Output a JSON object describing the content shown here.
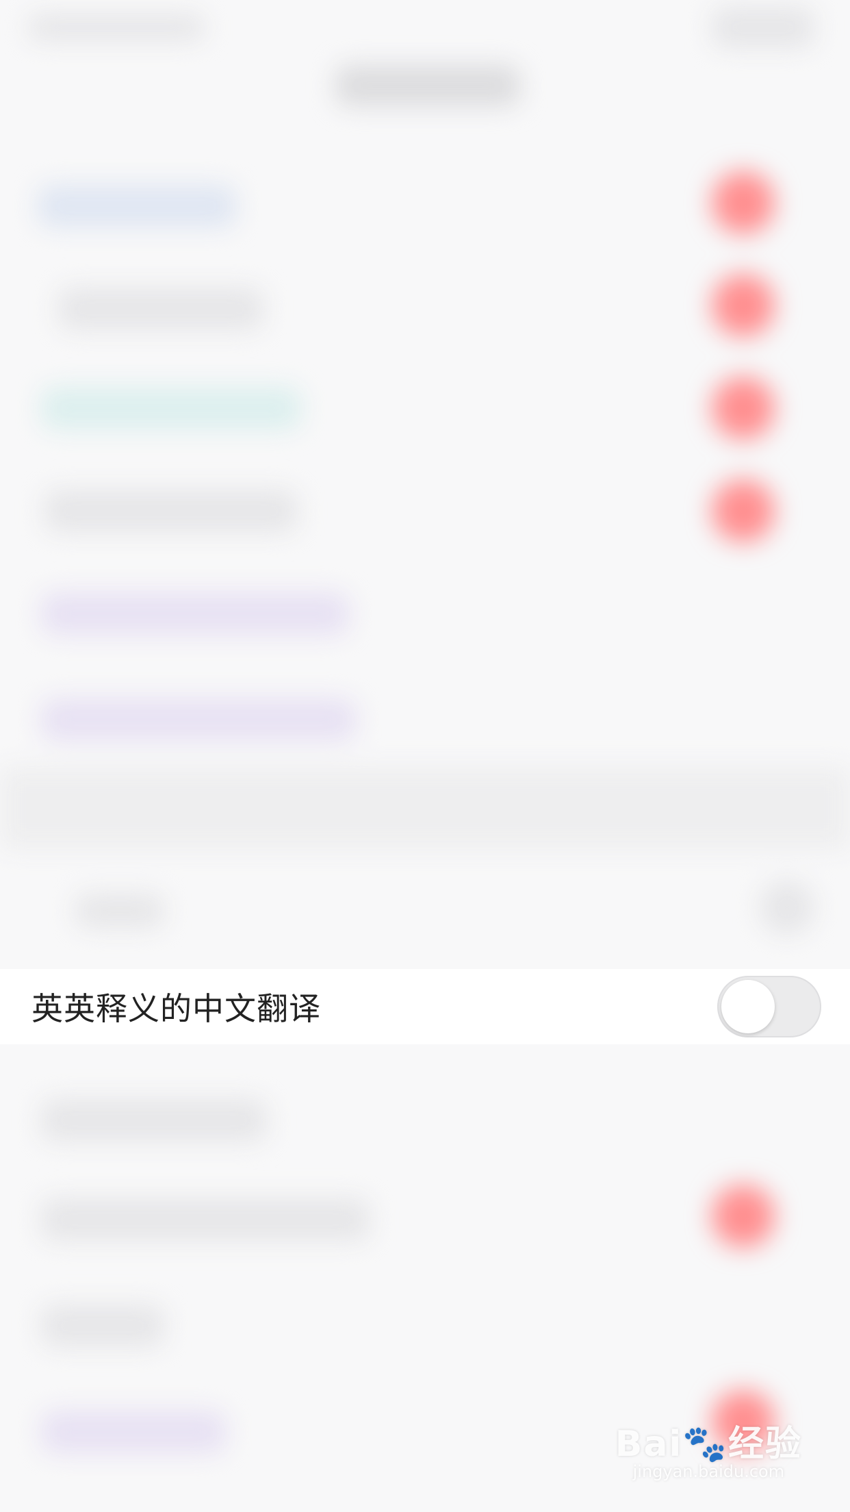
{
  "setting": {
    "label": "英英释义的中文翻译",
    "enabled": false
  },
  "watermark": {
    "logo_text": "Bai🐾经验",
    "url": "jingyan.baidu.com"
  },
  "colors": {
    "toggle_off_track": "#ebebec",
    "toggle_knob": "#ffffff",
    "row_background": "#ffffff",
    "blurred_accent": "#ff8f90"
  },
  "icons": {
    "watermark_icon": "paw-print-icon"
  }
}
